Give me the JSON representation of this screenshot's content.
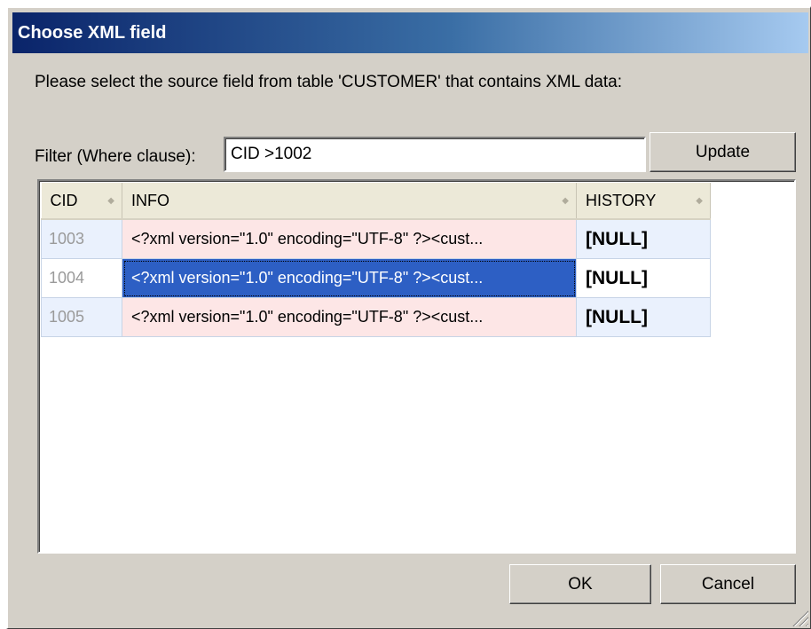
{
  "dialog": {
    "title": "Choose XML field",
    "prompt": "Please select the source field from table 'CUSTOMER' that contains XML data:"
  },
  "filter": {
    "label": "Filter (Where clause):",
    "value": "CID >1002",
    "update_label": "Update"
  },
  "grid": {
    "columns": [
      "CID",
      "INFO",
      "HISTORY"
    ],
    "rows": [
      {
        "cid": "1003",
        "info": "<?xml version=\"1.0\" encoding=\"UTF-8\" ?><cust...",
        "history": "[NULL]"
      },
      {
        "cid": "1004",
        "info": "<?xml version=\"1.0\" encoding=\"UTF-8\" ?><cust...",
        "history": "[NULL]",
        "selected": true
      },
      {
        "cid": "1005",
        "info": "<?xml version=\"1.0\" encoding=\"UTF-8\" ?><cust...",
        "history": "[NULL]"
      }
    ]
  },
  "buttons": {
    "ok": "OK",
    "cancel": "Cancel"
  },
  "colors": {
    "titlebar_start": "#0a246a",
    "selection": "#2d5fc4",
    "info_cell": "#fde6e6",
    "alt_row": "#eaf1fd"
  }
}
